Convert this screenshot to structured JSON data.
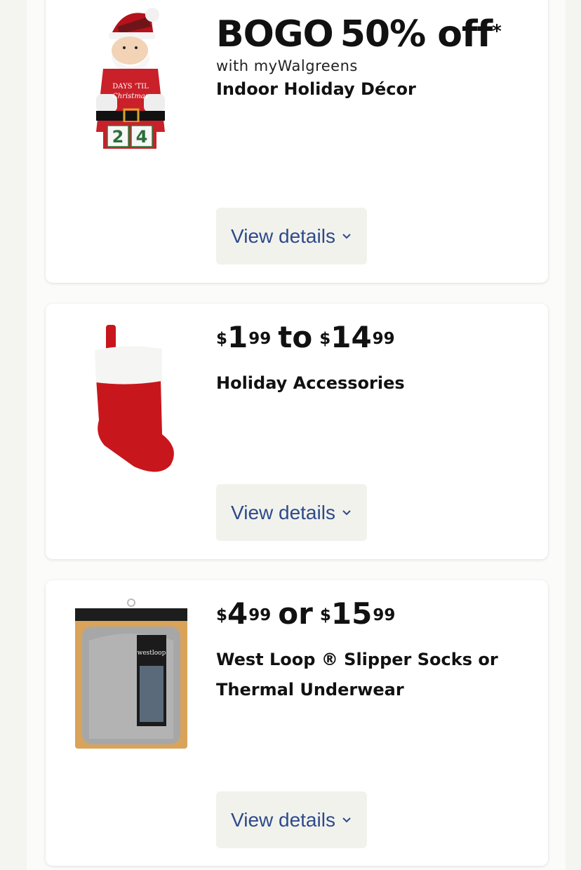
{
  "offers": [
    {
      "deal": {
        "prefix": "BOGO",
        "amount": "50% off",
        "asterisk": "*"
      },
      "note": "with myWalgreens",
      "title": "Indoor Holiday Décor",
      "image": {
        "calendar_line1": "DAYS 'TIL",
        "calendar_line2": "Christmas",
        "calendar_digits": [
          "2",
          "4"
        ]
      },
      "button_label": "View details",
      "button_icon": "chevron-down-icon"
    },
    {
      "price": {
        "low_dollars": "1",
        "low_cents": "99",
        "join": "to",
        "high_dollars": "14",
        "high_cents": "99",
        "currency": "$"
      },
      "title": "Holiday Accessories",
      "button_label": "View details",
      "button_icon": "chevron-down-icon"
    },
    {
      "price": {
        "low_dollars": "4",
        "low_cents": "99",
        "join": "or",
        "high_dollars": "15",
        "high_cents": "99",
        "currency": "$"
      },
      "title_line1": "West Loop ® Slipper Socks or",
      "title_line2": "Thermal Underwear",
      "image": {
        "brand": "westloop"
      },
      "button_label": "View details",
      "button_icon": "chevron-down-icon"
    }
  ],
  "colors": {
    "button_bg": "#f2f2ed",
    "button_text": "#2d4a8a",
    "stocking_red": "#c8161d"
  }
}
